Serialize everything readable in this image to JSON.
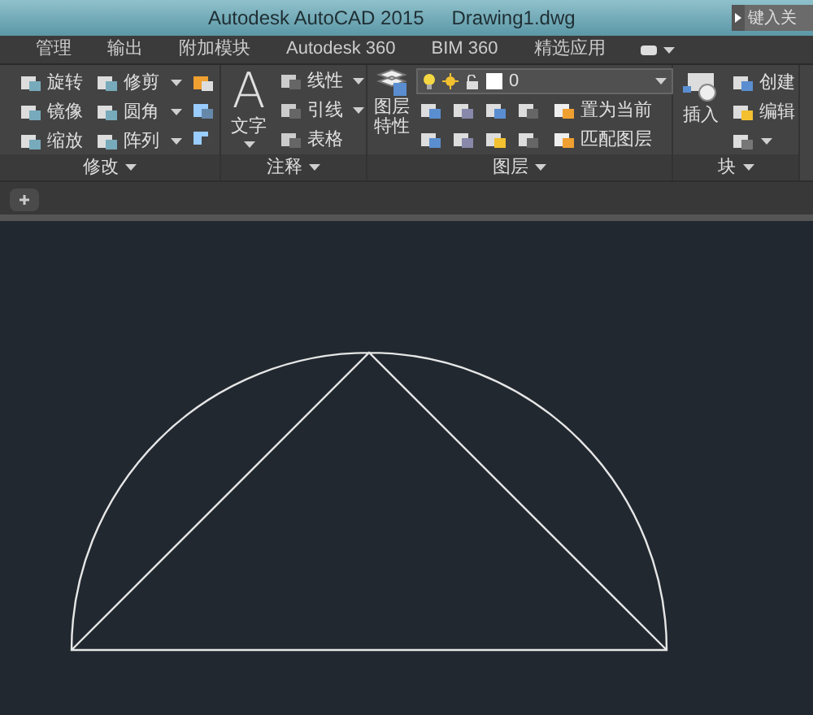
{
  "title_bar": {
    "app_title": "Autodesk AutoCAD 2015",
    "file_name": "Drawing1.dwg",
    "search_placeholder": "键入关"
  },
  "ribbon_tabs": [
    {
      "label": "管理",
      "selected": false
    },
    {
      "label": "输出",
      "selected": false
    },
    {
      "label": "附加模块",
      "selected": false
    },
    {
      "label": "Autodesk 360",
      "selected": false
    },
    {
      "label": "BIM 360",
      "selected": false
    },
    {
      "label": "精选应用",
      "selected": false
    }
  ],
  "panels": {
    "modify": {
      "title": "修改",
      "tools": [
        {
          "label": "旋转",
          "dropdown": false
        },
        {
          "label": "修剪",
          "dropdown": true
        },
        {
          "label": "镜像",
          "dropdown": false
        },
        {
          "label": "圆角",
          "dropdown": true
        },
        {
          "label": "缩放",
          "dropdown": false
        },
        {
          "label": "阵列",
          "dropdown": true
        }
      ]
    },
    "annotation": {
      "title": "注释",
      "big_glyph": "A",
      "big_label": "文字",
      "tools": [
        {
          "label": "线性",
          "dropdown": true
        },
        {
          "label": "引线",
          "dropdown": true
        },
        {
          "label": "表格",
          "dropdown": false
        }
      ]
    },
    "layers": {
      "title": "图层",
      "big_label": "图层特性",
      "current_layer": "0",
      "tools": [
        "置为当前",
        "匹配图层"
      ]
    },
    "block": {
      "title": "块",
      "big_label": "插入",
      "tools": [
        "创建",
        "编辑"
      ]
    }
  },
  "file_tabs": [
    {
      "kind": "new"
    }
  ]
}
